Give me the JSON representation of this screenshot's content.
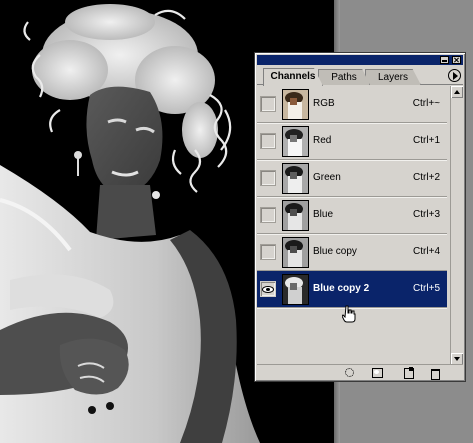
{
  "palette": {
    "tabs": [
      {
        "label": "Channels",
        "active": true
      },
      {
        "label": "Paths",
        "active": false
      },
      {
        "label": "Layers",
        "active": false
      }
    ],
    "channels": [
      {
        "name": "RGB",
        "shortcut": "Ctrl+~",
        "visible": false,
        "selected": false
      },
      {
        "name": "Red",
        "shortcut": "Ctrl+1",
        "visible": false,
        "selected": false
      },
      {
        "name": "Green",
        "shortcut": "Ctrl+2",
        "visible": false,
        "selected": false
      },
      {
        "name": "Blue",
        "shortcut": "Ctrl+3",
        "visible": false,
        "selected": false
      },
      {
        "name": "Blue copy",
        "shortcut": "Ctrl+4",
        "visible": false,
        "selected": false
      },
      {
        "name": "Blue copy 2",
        "shortcut": "Ctrl+5",
        "visible": true,
        "selected": true
      }
    ],
    "footer_icons": [
      "load-channel-as-selection-icon",
      "save-selection-as-channel-icon",
      "new-channel-icon",
      "delete-channel-icon"
    ]
  },
  "colors": {
    "selection": "#0a246a",
    "panel": "#d6d3ce",
    "canvas_background": "#000000",
    "workspace": "#8c8c8c"
  }
}
